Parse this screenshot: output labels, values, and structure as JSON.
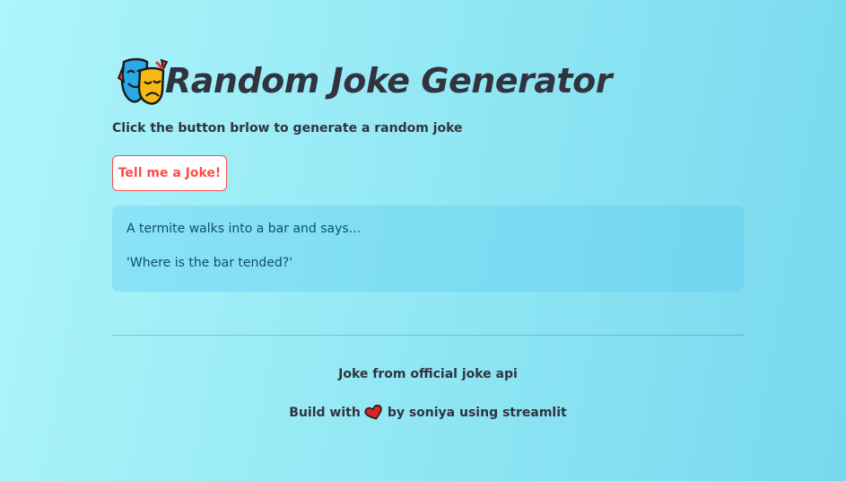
{
  "page": {
    "title": "Random Joke Generator",
    "title_icon": "performing-arts-masks-icon",
    "subtitle": "Click the button brlow to generate a random joke"
  },
  "button": {
    "label": "Tell me a Joke!"
  },
  "joke": {
    "setup": "A termite walks into a bar and says...",
    "punchline": "'Where is the bar tended?'"
  },
  "footer": {
    "source": "Joke from official joke api",
    "credit_prefix": "Build with",
    "credit_icon": "heart-icon",
    "credit_suffix": "by soniya using streamlit"
  },
  "colors": {
    "accent": "#ff4b4b",
    "text": "#31333f",
    "info_text": "#0e4f73",
    "background_start": "#aef5fb",
    "background_end": "#78d8ee"
  }
}
